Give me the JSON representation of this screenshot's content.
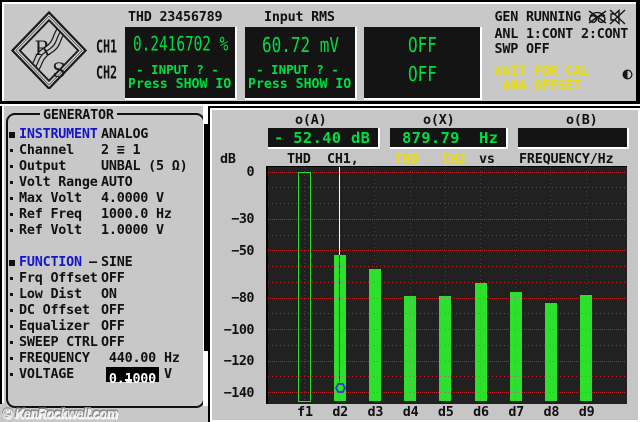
{
  "device": "audio-analyzer-crt-screen",
  "colors": {
    "background": "#c8c8c8",
    "panel_black": "#141414",
    "plot_black": "#1e1e1e",
    "display_green": "#00dd41",
    "bar_green": "#2ce02c",
    "grid_red": "#c22424",
    "warn_yellow": "#eadf00",
    "keyword_blue": "#1414c8",
    "cursor_white": "#ffffff",
    "cursor_blue": "#2436cc",
    "xor_magenta": "#cc3ccc"
  },
  "top_bar": {
    "logo": "rohde-schwarz-diamond",
    "channel_labels": [
      "CH1",
      "CH2"
    ],
    "displays": [
      {
        "header": "THD 23456789",
        "value": "0.2416702 %",
        "line2": "- INPUT ? -",
        "line3": "Press SHOW IO"
      },
      {
        "header": "Input RMS",
        "value": "60.72 mV",
        "line2": "- INPUT ? -",
        "line3": "Press SHOW IO"
      },
      {
        "header": "",
        "value": "OFF",
        "value2": "OFF"
      }
    ],
    "status": {
      "line1": "GEN RUNNING",
      "icons": [
        "headphones-muted-icon",
        "speaker-muted-icon"
      ],
      "line2": "ANL 1:CONT 2:CONT",
      "line3": "SWP OFF",
      "warn1": "WAIT FOR CAL",
      "warn2": "ANA OFFSET",
      "side_icon": "contrast-half-circle"
    }
  },
  "generator_menu": {
    "title": "GENERATOR",
    "rows": [
      {
        "bullet": "square",
        "label": "INSTRUMENT",
        "emph": true,
        "value": "ANALOG"
      },
      {
        "bullet": "dot",
        "label": "Channel",
        "value": "2 ≡ 1"
      },
      {
        "bullet": "dot",
        "label": "Output",
        "value": "UNBAL (5 Ω)"
      },
      {
        "bullet": "dot",
        "label": "Volt Range",
        "value": "AUTO"
      },
      {
        "bullet": "dot",
        "label": "Max Volt",
        "value": "4.0000 V"
      },
      {
        "bullet": "dot",
        "label": "Ref Freq",
        "value": "1000.0 Hz"
      },
      {
        "bullet": "dot",
        "label": "Ref Volt",
        "value": "1.0000 V"
      },
      {
        "spacer": true
      },
      {
        "bullet": "square",
        "label": "FUNCTION",
        "emph": true,
        "dash": "–",
        "value": "SINE"
      },
      {
        "bullet": "dot",
        "label": "Frq Offset",
        "value": "OFF"
      },
      {
        "bullet": "dot",
        "label": "Low Dist",
        "value": "ON"
      },
      {
        "bullet": "dot",
        "label": "DC Offset",
        "value": "OFF"
      },
      {
        "bullet": "dot",
        "label": "Equalizer",
        "value": "OFF"
      },
      {
        "bullet": "dot",
        "label": "SWEEP CTRL",
        "value": "OFF"
      },
      {
        "bullet": "dot",
        "label": "FREQUENCY",
        "value": "440.00",
        "unit": "Hz",
        "indent": 1
      },
      {
        "bullet": "dot",
        "label": "VOLTAGE",
        "value": "0.1000",
        "unit": "V",
        "indent": 1,
        "highlight": true,
        "cursor_char": 2
      }
    ]
  },
  "graph": {
    "readouts": [
      {
        "label": "o(A)",
        "value": "- 52.40 dB"
      },
      {
        "label": "o(X)",
        "value": "879.79  Hz"
      },
      {
        "label": "o(B)",
        "value": ""
      }
    ],
    "trace_header": {
      "y_unit": "dB",
      "trace1_name": "THD",
      "trace1_channel": "CH1,",
      "trace2_name": "THD",
      "trace2_channel": "CH2",
      "vs": "vs",
      "x_axis": "FREQUENCY/Hz"
    }
  },
  "chart_data": {
    "type": "bar",
    "title": "THD CH1, THD CH2 vs FREQUENCY/Hz",
    "categories": [
      "f1",
      "d2",
      "d3",
      "d4",
      "d5",
      "d6",
      "d7",
      "d8",
      "d9"
    ],
    "values": [
      0,
      -52.4,
      -61.7,
      -78.6,
      -78.4,
      -70.6,
      -76.0,
      -82.9,
      -78.0
    ],
    "bar_styles": [
      "hollow",
      "filled",
      "filled",
      "filled",
      "filled",
      "filled",
      "filled",
      "filled",
      "filled"
    ],
    "ylabel": "dB",
    "xlabel": "FREQUENCY/Hz",
    "ylim": [
      -140,
      0
    ],
    "grid_step_db": 10,
    "ytick_labels": [
      0,
      -30,
      -50,
      -80,
      -100,
      -120,
      -140
    ],
    "grid": "dotted-red",
    "cursor": {
      "category": "d2",
      "readout_a_db": -52.4,
      "readout_x_hz": 879.79,
      "o_marker_db": -137
    }
  },
  "watermark": "© KenRockwell.com"
}
